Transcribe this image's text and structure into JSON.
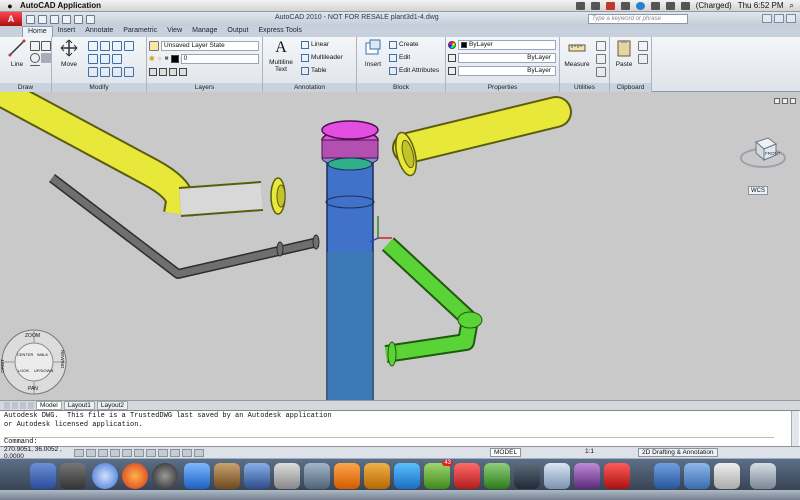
{
  "menubar": {
    "apple": "",
    "app_name": "AutoCAD Application",
    "battery": "(Charged)",
    "clock": "Thu 6:52 PM"
  },
  "titlebar": {
    "app_button": "A",
    "title": "AutoCAD 2010 - NOT FOR RESALE     plant3d1-4.dwg",
    "search_placeholder": "Type a keyword or phrase"
  },
  "ribbon": {
    "tabs": [
      "Home",
      "Insert",
      "Annotate",
      "Parametric",
      "View",
      "Manage",
      "Output",
      "Express Tools"
    ],
    "draw": {
      "title": "Draw",
      "line": "Line"
    },
    "modify": {
      "title": "Modify",
      "move": "Move"
    },
    "layers": {
      "title": "Layers",
      "layer_state": "Unsaved Layer State",
      "current_layer": "0"
    },
    "annotation": {
      "title": "Annotation",
      "multiline_text": "Multiline Text",
      "linear": "Linear",
      "multileader": "Multileader",
      "table": "Table"
    },
    "block": {
      "title": "Block",
      "insert": "Insert",
      "create": "Create",
      "edit": "Edit",
      "edit_attributes": "Edit Attributes"
    },
    "properties": {
      "title": "Properties",
      "color": "ByLayer",
      "linetype": "ByLayer",
      "lineweight": "ByLayer"
    },
    "utilities": {
      "title": "Utilities",
      "measure": "Measure"
    },
    "clipboard": {
      "title": "Clipboard",
      "paste": "Paste"
    }
  },
  "viewport": {
    "navwheel": {
      "top": "ZOOM",
      "left": "ORBIT",
      "right": "REWIND",
      "bottom": "PAN",
      "center": "CENTER",
      "walk": "WALK",
      "look": "LOOK",
      "up_down": "UP/DOWN"
    },
    "viewcube_face": "FRONT",
    "wcs": "WCS"
  },
  "layout_tabs": [
    "Model",
    "Layout1",
    "Layout2"
  ],
  "command": {
    "line1": "Autodesk DWG.  This file is a TrustedDWG last saved by an Autodesk application",
    "line2": "or Autodesk licensed application.",
    "prompt": "Command:"
  },
  "status": {
    "coords": "270.9051, 36.0052 , 0.0000",
    "model": "MODEL",
    "scale": "1:1",
    "workspace": "2D Drafting & Annotation"
  },
  "dock": {
    "badge": "43"
  },
  "colors": {
    "pipe_yellow": "#e8e83a",
    "pipe_green": "#5ad336",
    "pipe_gray": "#6f6f6f",
    "vessel_blue": "#3f72c8",
    "flange_magenta": "#e24fe0",
    "viewport_bg": "#c9c9c9"
  }
}
